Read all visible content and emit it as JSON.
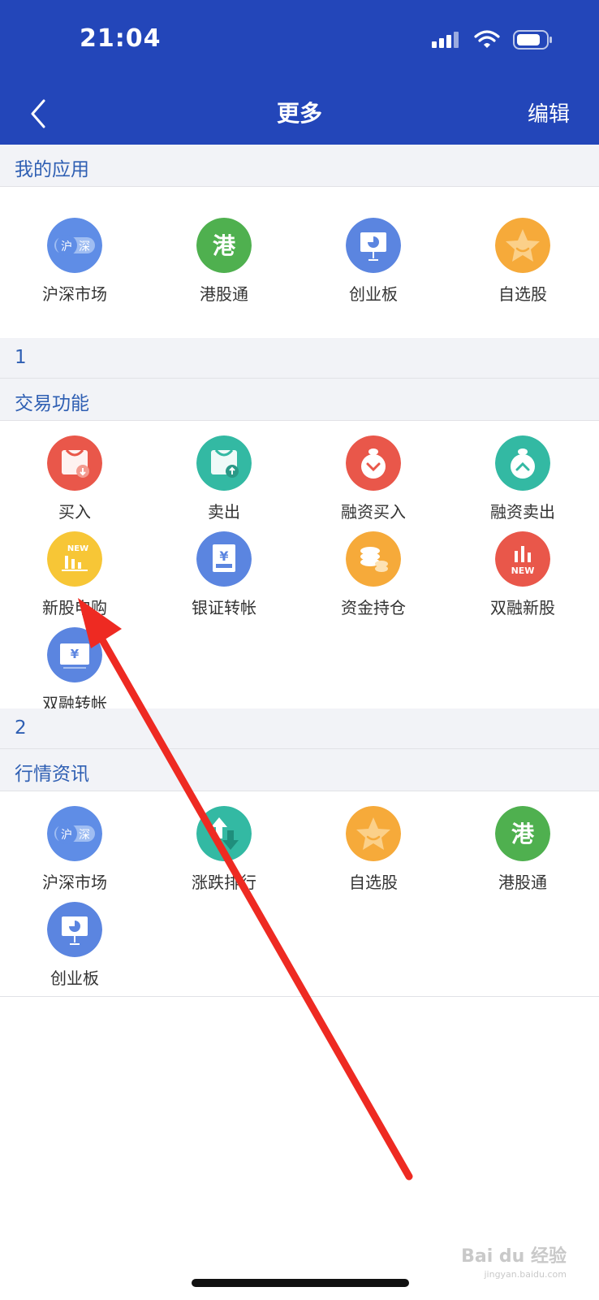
{
  "status_bar": {
    "time": "21:04"
  },
  "nav": {
    "title": "更多",
    "edit": "编辑"
  },
  "sections": {
    "my_apps": {
      "title": "我的应用"
    },
    "number1": "1",
    "trading": {
      "title": "交易功能"
    },
    "number2": "2",
    "market": {
      "title": "行情资讯"
    }
  },
  "my_apps": [
    {
      "label": "沪深市场",
      "icon": "hushen-icon",
      "color": "#5f8de6"
    },
    {
      "label": "港股通",
      "icon": "gang-icon",
      "color": "#4fb04f"
    },
    {
      "label": "创业板",
      "icon": "presentation-icon",
      "color": "#5b85e0"
    },
    {
      "label": "自选股",
      "icon": "star-icon",
      "color": "#f6aa3a"
    }
  ],
  "trading": [
    {
      "label": "买入",
      "icon": "bag-down-icon",
      "color": "#e9574a"
    },
    {
      "label": "卖出",
      "icon": "bag-up-icon",
      "color": "#33b9a3"
    },
    {
      "label": "融资买入",
      "icon": "moneybag-down-icon",
      "color": "#e9574a"
    },
    {
      "label": "融资卖出",
      "icon": "moneybag-up-icon",
      "color": "#33b9a3"
    },
    {
      "label": "新股申购",
      "icon": "new-chart-icon",
      "color": "#f7c636"
    },
    {
      "label": "银证转帐",
      "icon": "yen-card-icon",
      "color": "#5b85e0"
    },
    {
      "label": "资金持仓",
      "icon": "coins-icon",
      "color": "#f6aa3a"
    },
    {
      "label": "双融新股",
      "icon": "new-bars-icon",
      "color": "#e9574a"
    },
    {
      "label": "双融转帐",
      "icon": "yen-screen-icon",
      "color": "#5b85e0"
    }
  ],
  "market": [
    {
      "label": "沪深市场",
      "icon": "hushen-icon",
      "color": "#5f8de6"
    },
    {
      "label": "涨跌排行",
      "icon": "updown-icon",
      "color": "#33b9a3"
    },
    {
      "label": "自选股",
      "icon": "star-icon",
      "color": "#f6aa3a"
    },
    {
      "label": "港股通",
      "icon": "gang-icon",
      "color": "#4fb04f"
    },
    {
      "label": "创业板",
      "icon": "presentation-icon",
      "color": "#5b85e0"
    }
  ],
  "icon_glyphs": {
    "hu": "沪",
    "shen": "深",
    "gang": "港",
    "yen": "¥",
    "new": "NEW"
  },
  "watermark": {
    "brand": "Bai du 经验",
    "url": "jingyan.baidu.com"
  },
  "colors": {
    "header": "#2346b9",
    "section_text": "#2f5fb3",
    "arrow": "#ee2a22"
  }
}
